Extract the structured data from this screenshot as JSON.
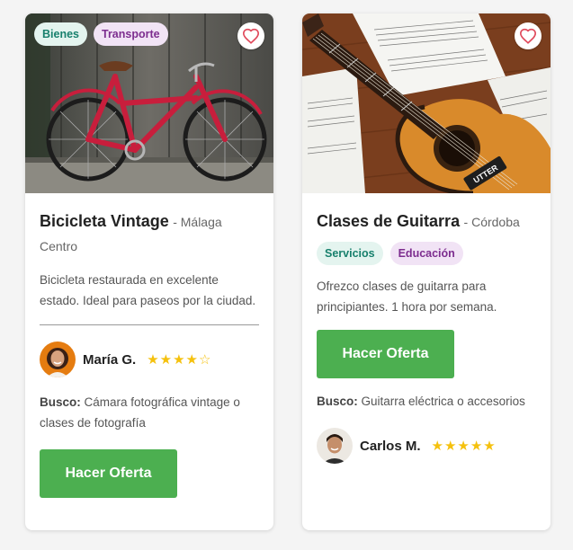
{
  "listings": [
    {
      "tags": [
        "Bienes",
        "Transporte"
      ],
      "title": "Bicicleta Vintage",
      "location": "- Málaga Centro",
      "description": "Bicicleta restaurada en excelente estado. Ideal para paseos por la ciudad.",
      "owner": {
        "name": "María G.",
        "rating": 4,
        "stars": "★★★★☆"
      },
      "seeking_label": "Busco:",
      "seeking_text": "Cámara fotográfica vintage o clases de fotografía",
      "offer_label": "Hacer Oferta",
      "favorite_icon": "heart-outline-icon"
    },
    {
      "tags": [
        "Servicios",
        "Educación"
      ],
      "title": "Clases de Guitarra",
      "location": "- Córdoba",
      "description": "Ofrezco clases de guitarra para principiantes. 1 hora por semana.",
      "owner": {
        "name": "Carlos M.",
        "rating": 5,
        "stars": "★★★★★"
      },
      "seeking_label": "Busco:",
      "seeking_text": "Guitarra eléctrica o accesorios",
      "offer_label": "Hacer Oferta",
      "favorite_icon": "heart-outline-icon",
      "guitar_brand": "UTTER"
    }
  ],
  "colors": {
    "accent_green": "#4caf50",
    "tag_green_text": "#18806d",
    "tag_purple_text": "#7d2d8f",
    "star": "#f5c10d",
    "heart": "#e0495b"
  }
}
